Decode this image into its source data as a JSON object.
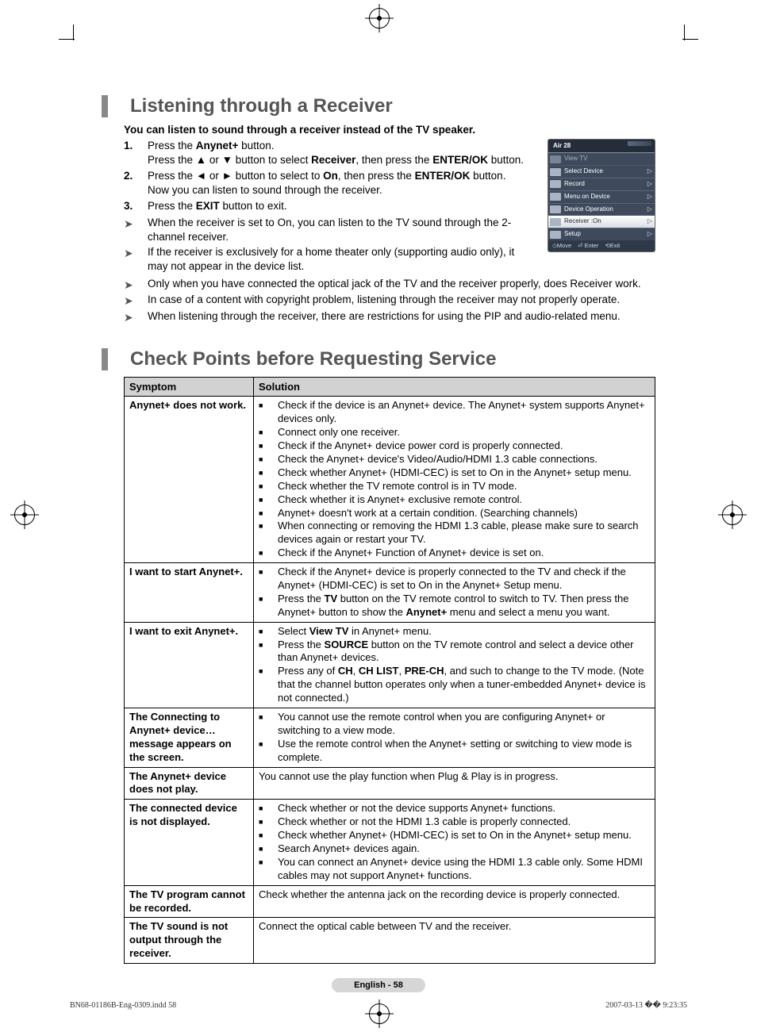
{
  "section1": {
    "title": "Listening through a Receiver",
    "intro": "You can listen to sound through a receiver instead of the TV speaker.",
    "steps": [
      "Press the <b>Anynet+</b> button.<br>Press the ▲ or ▼ button to select <b>Receiver</b>, then press the <b>ENTER/OK</b> button.",
      "Press the ◄ or ► button to select to <b>On</b>, then press the <b>ENTER/OK</b> button.<br>Now you can listen to sound through the receiver.",
      "Press the <b>EXIT</b> button to exit."
    ],
    "notes_narrow": [
      "When the receiver is set to On, you can listen to the TV sound through the 2-channel receiver.",
      "If the receiver is exclusively for a home theater only (supporting audio only), it may not appear in the device list."
    ],
    "notes_wide": [
      "Only when you have connected the optical jack of the TV and the receiver properly, does Receiver work.",
      "In case of a content with copyright problem, listening through the receiver may not properly operate.",
      "When listening through the receiver, there are restrictions for using the PIP and audio-related menu."
    ]
  },
  "osd": {
    "title": "Air 28",
    "items": [
      {
        "label": "View TV",
        "disabled": true,
        "chev": ""
      },
      {
        "label": "Select Device",
        "chev": "▷"
      },
      {
        "label": "Record",
        "chev": "▷"
      },
      {
        "label": "Menu on Device",
        "chev": "▷"
      },
      {
        "label": "Device Operation",
        "chev": "▷"
      },
      {
        "label": "Receiver    :On",
        "chev": "▷",
        "selected": true
      },
      {
        "label": "Setup",
        "chev": "▷"
      }
    ],
    "footer": {
      "move": "Move",
      "enter": "Enter",
      "exit": "Exit"
    }
  },
  "section2": {
    "title": "Check Points before Requesting Service",
    "headers": [
      "Symptom",
      "Solution"
    ],
    "rows": [
      {
        "symptom": "Anynet+ does not work.",
        "solution": [
          "Check if the device is an Anynet+ device. The Anynet+ system supports Anynet+ devices only.",
          "Connect only one receiver.",
          "Check if the Anynet+ device power cord is properly connected.",
          "Check the Anynet+ device's Video/Audio/HDMI 1.3 cable connections.",
          "Check whether Anynet+ (HDMI-CEC) is set to On in the Anynet+ setup menu.",
          "Check whether the TV remote control is in TV mode.",
          "Check whether it is Anynet+ exclusive remote control.",
          "Anynet+ doesn't work at a certain condition. (Searching channels)",
          "When connecting or removing the HDMI 1.3 cable, please make sure to search devices again or restart your TV.",
          "Check if the Anynet+ Function of Anynet+ device is set on."
        ]
      },
      {
        "symptom": "I want to start Anynet+.",
        "solution": [
          "Check if the Anynet+ device is properly connected to the TV and check if the Anynet+ (HDMI-CEC) is set to On in the Anynet+ Setup menu.",
          "Press the <b>TV</b> button on the TV remote control to switch to TV. Then press the Anynet+ button to show the <b>Anynet+</b> menu and select a menu you want."
        ]
      },
      {
        "symptom": "I want to exit Anynet+.",
        "solution": [
          "Select <b>View TV</b> in Anynet+ menu.",
          "Press the <b>SOURCE</b> button on the TV remote control and select a device other than Anynet+ devices.",
          "Press any of <b>CH</b>, <b>CH LIST</b>, <b>PRE-CH</b>, and such to change to the TV mode. (Note that the channel button operates only when a tuner-embedded Anynet+ device is not connected.)"
        ]
      },
      {
        "symptom": "The Connecting to Anynet+ device… message appears on the screen.",
        "solution": [
          "You cannot use the remote control when you are configuring Anynet+ or switching to a view mode.",
          "Use the remote control when the Anynet+ setting or switching to view mode is complete."
        ]
      },
      {
        "symptom": "The Anynet+ device does not play.",
        "plain": "You cannot use the play function when Plug & Play is in progress."
      },
      {
        "symptom": "The connected device is not displayed.",
        "solution": [
          "Check whether or not the device supports Anynet+ functions.",
          "Check whether or not the HDMI 1.3 cable is properly connected.",
          "Check whether Anynet+ (HDMI-CEC) is set to On in the Anynet+ setup menu.",
          "Search Anynet+ devices again.",
          "You can connect an Anynet+ device using the HDMI 1.3 cable only. Some HDMI cables may not support Anynet+ functions."
        ]
      },
      {
        "symptom": "The TV program cannot be recorded.",
        "plain": "Check whether the antenna jack on the recording device is properly connected."
      },
      {
        "symptom": "The TV sound is not output through the receiver.",
        "plain": "Connect the optical cable between TV and the receiver."
      }
    ]
  },
  "page_badge": "English - 58",
  "footer": {
    "left": "BN68-01186B-Eng-0309.indd   58",
    "right": "2007-03-13   �� 9:23:35"
  }
}
